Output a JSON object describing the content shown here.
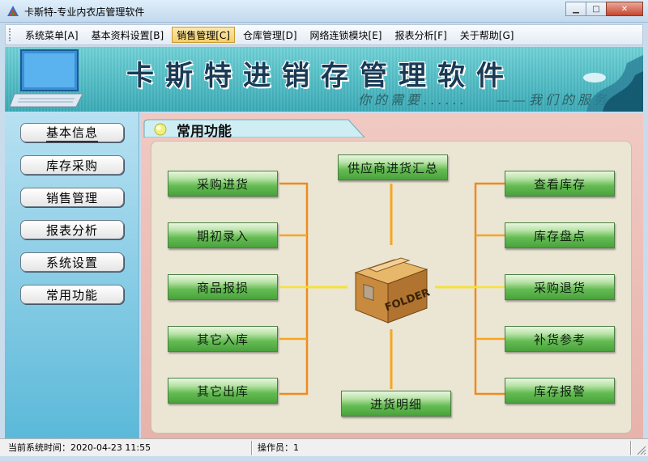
{
  "window": {
    "title": "卡斯特-专业内衣店管理软件",
    "controls": [
      "minimize",
      "maximize",
      "close"
    ]
  },
  "menu": [
    "系统菜单[A]",
    "基本资料设置[B]",
    "销售管理[C]",
    "仓库管理[D]",
    "网络连锁模块[E]",
    "报表分析[F]",
    "关于帮助[G]"
  ],
  "menu_active": "销售管理[C]",
  "banner": {
    "title": "卡斯特进销存管理软件",
    "slogan": "你的需要......    ——我们的服务"
  },
  "sidebar": {
    "items": [
      "基本信息",
      "库存采购",
      "销售管理",
      "报表分析",
      "系统设置",
      "常用功能"
    ]
  },
  "panel": {
    "title": "常用功能",
    "left_buttons": [
      "采购进货",
      "期初录入",
      "商品报损",
      "其它入库",
      "其它出库"
    ],
    "right_buttons": [
      "查看库存",
      "库存盘点",
      "采购退货",
      "补货参考",
      "库存报警"
    ],
    "top_button": "供应商进货汇总",
    "bottom_button": "进货明细",
    "center_icon_label": "FOLDER"
  },
  "status": {
    "time_label": "当前系统时间：",
    "time_value": "2020-04-23 11:55",
    "operator_label": "操作员：",
    "operator_value": "1"
  },
  "colors": {
    "accent_yellow": "#f5e23a",
    "accent_orange": "#f08a1c",
    "button_green": "#4aa23c",
    "sidebar_blue": "#5bb9d9"
  }
}
